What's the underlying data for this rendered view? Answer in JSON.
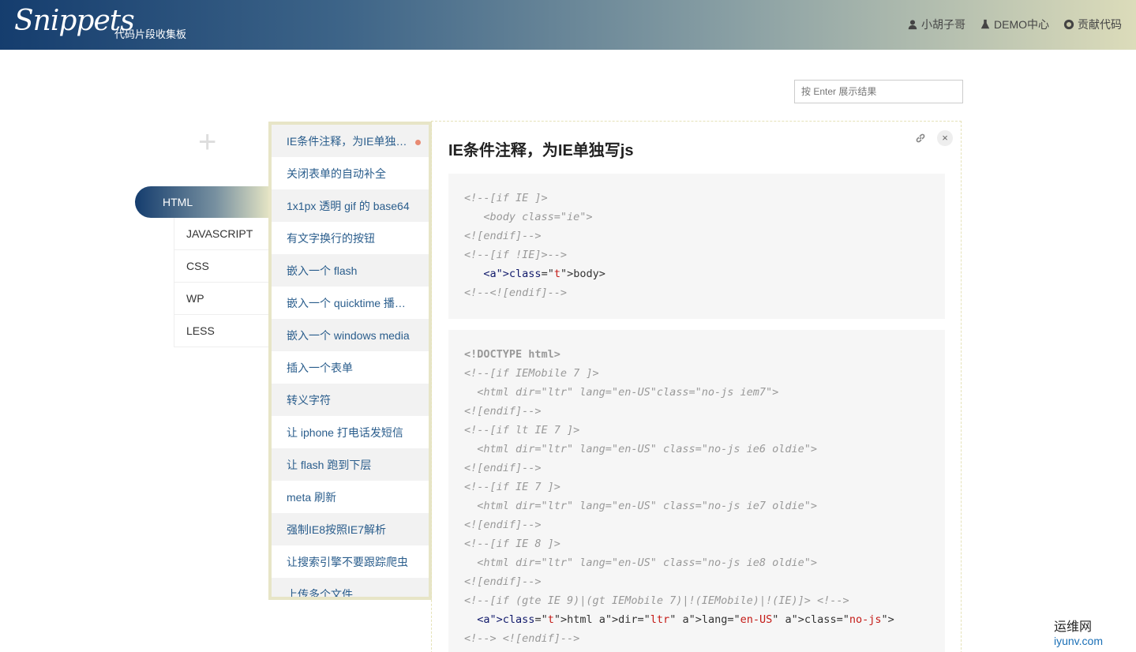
{
  "header": {
    "logo": "Snippets",
    "tagline": "代码片段收集板",
    "nav": [
      {
        "label": "小胡子哥",
        "icon": "user-icon"
      },
      {
        "label": "DEMO中心",
        "icon": "flask-icon"
      },
      {
        "label": "贡献代码",
        "icon": "github-icon"
      }
    ]
  },
  "search": {
    "placeholder": "按 Enter 展示结果"
  },
  "add_symbol": "+",
  "categories": {
    "active": "HTML",
    "items": [
      "JAVASCRIPT",
      "CSS",
      "WP",
      "LESS"
    ]
  },
  "snippets": [
    "IE条件注释，为IE单独写js",
    "关闭表单的自动补全",
    "1x1px 透明 gif 的 base64",
    "有文字换行的按钮",
    "嵌入一个 flash",
    "嵌入一个 quicktime 播放器",
    "嵌入一个 windows media",
    "插入一个表单",
    "转义字符",
    "让 iphone 打电话发短信",
    "让 flash 跑到下层",
    "meta 刷新",
    "强制IE8按照IE7解析",
    "让搜索引擎不要跟踪爬虫",
    "上传多个文件"
  ],
  "detail": {
    "title": "IE条件注释，为IE单独写js",
    "close": "×",
    "code1": [
      "<!--[if IE ]>",
      "   <body class=\"ie\">",
      "<![endif]-->",
      "<!--[if !IE]>-->",
      "   <body>",
      "<!--<![endif]-->"
    ],
    "code2": [
      "<!DOCTYPE html>",
      "<!--[if IEMobile 7 ]>",
      "  <html dir=\"ltr\" lang=\"en-US\"class=\"no-js iem7\">",
      "<![endif]-->",
      "<!--[if lt IE 7 ]>",
      "  <html dir=\"ltr\" lang=\"en-US\" class=\"no-js ie6 oldie\">",
      "<![endif]-->",
      "<!--[if IE 7 ]>",
      "  <html dir=\"ltr\" lang=\"en-US\" class=\"no-js ie7 oldie\">",
      "<![endif]-->",
      "<!--[if IE 8 ]>",
      "  <html dir=\"ltr\" lang=\"en-US\" class=\"no-js ie8 oldie\">",
      "<![endif]-->",
      "<!--[if (gte IE 9)|(gt IEMobile 7)|!(IEMobile)|!(IE)]> <!-->",
      "  <html dir=\"ltr\" lang=\"en-US\" class=\"no-js\">",
      "<!--> <![endif]-->"
    ]
  },
  "watermark": {
    "text": "运维网",
    "url": "iyunv.com",
    "overlay": "小胡子哥"
  }
}
